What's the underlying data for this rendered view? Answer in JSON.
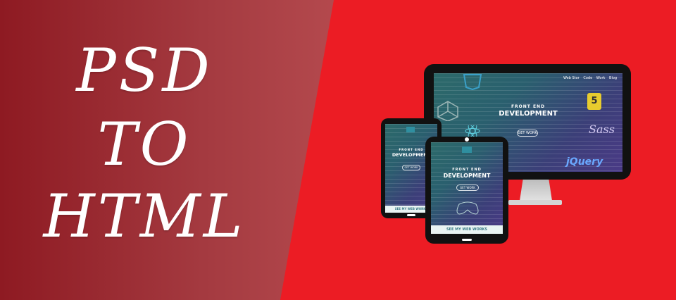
{
  "banner": {
    "title_lines": [
      "PSD",
      "TO",
      "HTML"
    ],
    "colors": {
      "right_bg": "#ec1c24",
      "left_gradient_start": "#8e1a22",
      "left_gradient_end": "#d06265"
    }
  },
  "devices": {
    "monitor": {
      "nav_items": [
        "Web Stor",
        "Code",
        "Work",
        "Blog"
      ],
      "line1": "FRONT END",
      "headline": "DEVELOPMENT",
      "button": "GET WORK",
      "logos": [
        "5",
        "Sass",
        "jQuery"
      ]
    },
    "tablet_small": {
      "headline_top": "FRONT END",
      "headline": "DEVELOPMENT",
      "button": "GET WORK",
      "footer": "SEE MY WEB WORKS"
    },
    "tablet_front": {
      "headline_top": "FRONT END",
      "headline": "DEVELOPMENT",
      "button": "GET WORK",
      "footer": "SEE MY WEB WORKS"
    }
  }
}
